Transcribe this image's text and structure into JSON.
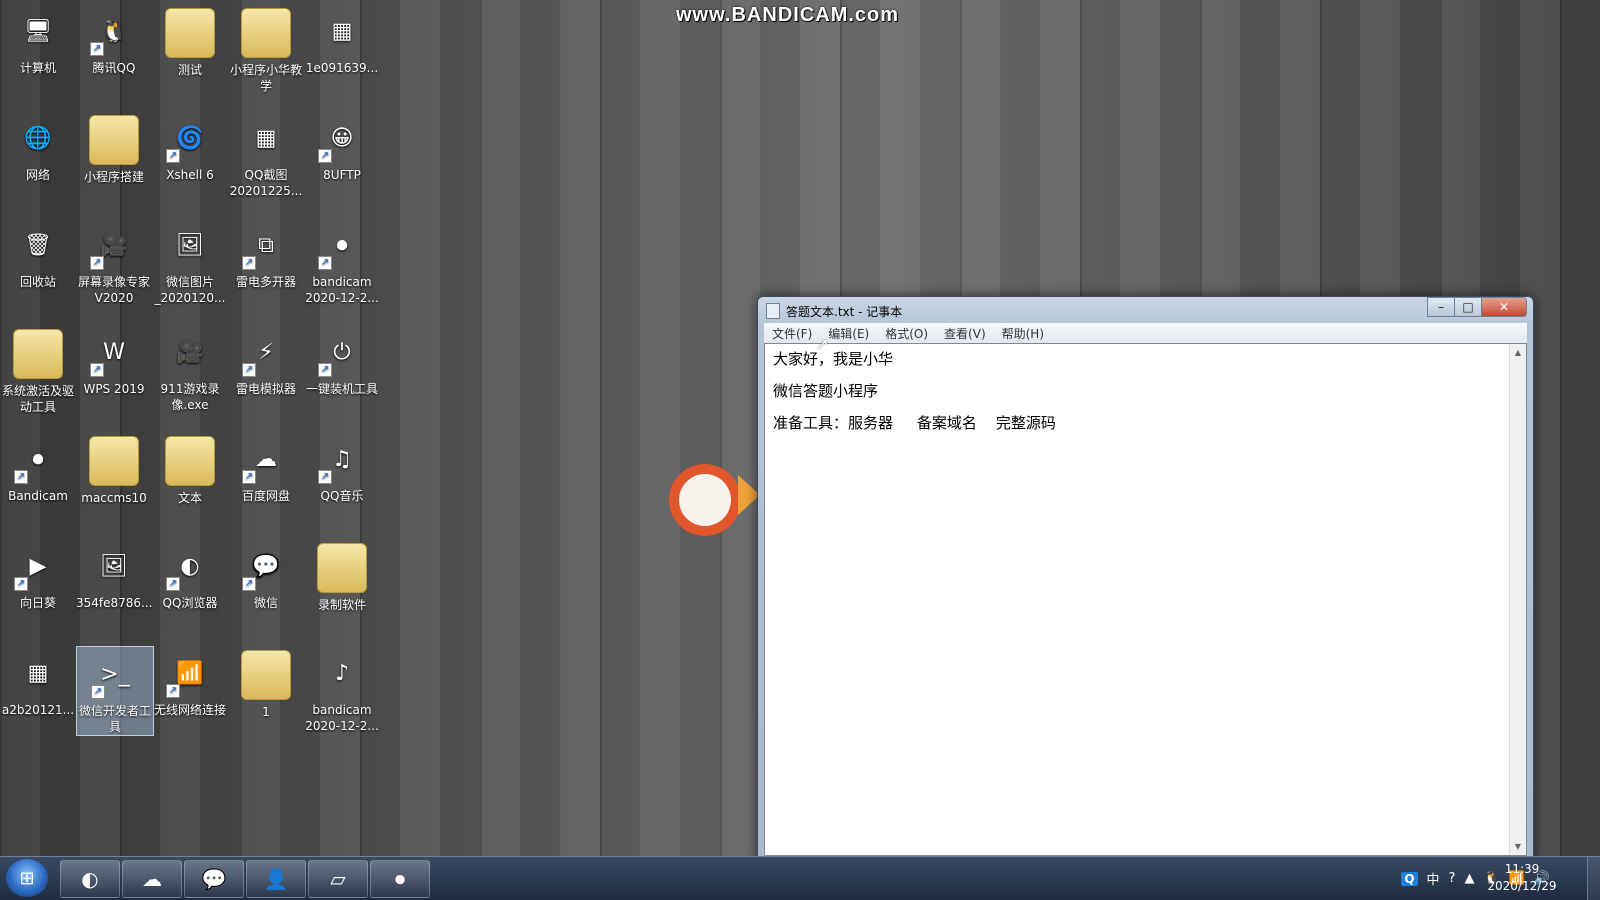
{
  "watermark": "www.BANDICAM.com",
  "desktop_icons": [
    {
      "label": "计算机",
      "glyph": "🖥",
      "shortcut": false
    },
    {
      "label": "腾讯QQ",
      "glyph": "🐧",
      "shortcut": true
    },
    {
      "label": "测试",
      "glyph": "",
      "shortcut": false,
      "folder": true
    },
    {
      "label": "小程序小华教学",
      "glyph": "",
      "shortcut": false,
      "folder": true
    },
    {
      "label": "1e091639...",
      "glyph": "▦",
      "shortcut": false
    },
    {
      "label": "网络",
      "glyph": "🌐",
      "shortcut": false
    },
    {
      "label": "小程序搭建",
      "glyph": "",
      "shortcut": false,
      "folder": true
    },
    {
      "label": "Xshell 6",
      "glyph": "🌀",
      "shortcut": true
    },
    {
      "label": "QQ截图20201225...",
      "glyph": "▦",
      "shortcut": false
    },
    {
      "label": "8UFTP",
      "glyph": "😀",
      "shortcut": true
    },
    {
      "label": "回收站",
      "glyph": "🗑",
      "shortcut": false
    },
    {
      "label": "屏幕录像专家V2020",
      "glyph": "🎥",
      "shortcut": true
    },
    {
      "label": "微信图片_2020120...",
      "glyph": "🖼",
      "shortcut": false
    },
    {
      "label": "雷电多开器",
      "glyph": "⧉",
      "shortcut": true
    },
    {
      "label": "bandicam 2020-12-2...",
      "glyph": "⏺",
      "shortcut": true
    },
    {
      "label": "系统激活及驱动工具",
      "glyph": "",
      "shortcut": false,
      "folder": true
    },
    {
      "label": "WPS 2019",
      "glyph": "W",
      "shortcut": true
    },
    {
      "label": "911游戏录像.exe",
      "glyph": "🎥",
      "shortcut": false
    },
    {
      "label": "雷电模拟器",
      "glyph": "⚡",
      "shortcut": true
    },
    {
      "label": "一键装机工具",
      "glyph": "⏻",
      "shortcut": true
    },
    {
      "label": "Bandicam",
      "glyph": "⏺",
      "shortcut": true
    },
    {
      "label": "maccms10",
      "glyph": "",
      "shortcut": false,
      "folder": true
    },
    {
      "label": "文本",
      "glyph": "",
      "shortcut": false,
      "folder": true
    },
    {
      "label": "百度网盘",
      "glyph": "☁",
      "shortcut": true
    },
    {
      "label": "QQ音乐",
      "glyph": "♫",
      "shortcut": true
    },
    {
      "label": "向日葵",
      "glyph": "▶",
      "shortcut": true
    },
    {
      "label": "354fe8786...",
      "glyph": "🖼",
      "shortcut": false
    },
    {
      "label": "QQ浏览器",
      "glyph": "◐",
      "shortcut": true
    },
    {
      "label": "微信",
      "glyph": "💬",
      "shortcut": true
    },
    {
      "label": "录制软件",
      "glyph": "",
      "shortcut": false,
      "folder": true
    },
    {
      "label": "a2b20121...",
      "glyph": "▦",
      "shortcut": false
    },
    {
      "label": "微信开发者工具",
      "glyph": ">_",
      "shortcut": true,
      "selected": true
    },
    {
      "label": "无线网络连接",
      "glyph": "📶",
      "shortcut": true
    },
    {
      "label": "1",
      "glyph": "",
      "shortcut": false,
      "folder": true
    },
    {
      "label": "bandicam 2020-12-2...",
      "glyph": "♪",
      "shortcut": false
    }
  ],
  "notepad": {
    "title": "答题文本.txt - 记事本",
    "menu": [
      "文件(F)",
      "编辑(E)",
      "格式(O)",
      "查看(V)",
      "帮助(H)"
    ],
    "lines": [
      "大家好，我是小华",
      "微信答题小程序",
      "准备工具：服务器     备案域名    完整源码"
    ],
    "controls": {
      "minimize": "–",
      "maximize": "□",
      "close": "✕"
    }
  },
  "taskbar": {
    "start_glyph": "⊞",
    "pinned": [
      {
        "name": "qq-browser",
        "glyph": "◐"
      },
      {
        "name": "baidu-netdisk",
        "glyph": "☁"
      },
      {
        "name": "wechat",
        "glyph": "💬"
      },
      {
        "name": "avatar-app",
        "glyph": "👤"
      },
      {
        "name": "notepad",
        "glyph": "▱"
      },
      {
        "name": "bandicam",
        "glyph": "⏺"
      }
    ],
    "tray": {
      "ime_q": "Q",
      "ime_lang": "中",
      "help": "?",
      "arrow": "▲"
    },
    "time": "11:39",
    "date": "2020/12/29"
  },
  "colors": {
    "accent": "#1e7fe0",
    "close_button": "#c34a32",
    "taskbar": "#1f2c40"
  }
}
